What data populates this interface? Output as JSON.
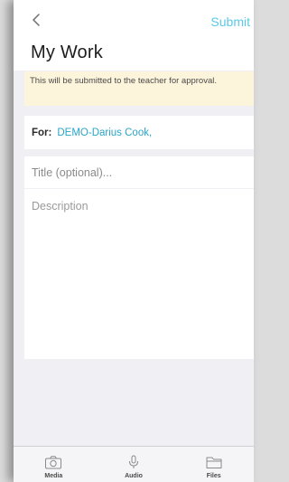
{
  "header": {
    "back_icon": "chevron-left-icon",
    "submit_label": "Submit",
    "title": "My Work"
  },
  "notice": {
    "text": "This will be submitted to the teacher for approval."
  },
  "recipient": {
    "label": "For:",
    "value": "DEMO-Darius Cook,"
  },
  "form": {
    "title_placeholder": "Title (optional)...",
    "title_value": "",
    "description_placeholder": "Description",
    "description_value": ""
  },
  "tabs": [
    {
      "label": "Media",
      "icon": "camera-icon"
    },
    {
      "label": "Audio",
      "icon": "microphone-icon"
    },
    {
      "label": "Files",
      "icon": "folder-icon"
    }
  ],
  "colors": {
    "accent": "#5ac8e6",
    "recipient": "#2aa5c9",
    "notice_bg": "#fcf4db",
    "background": "#efeff4"
  }
}
